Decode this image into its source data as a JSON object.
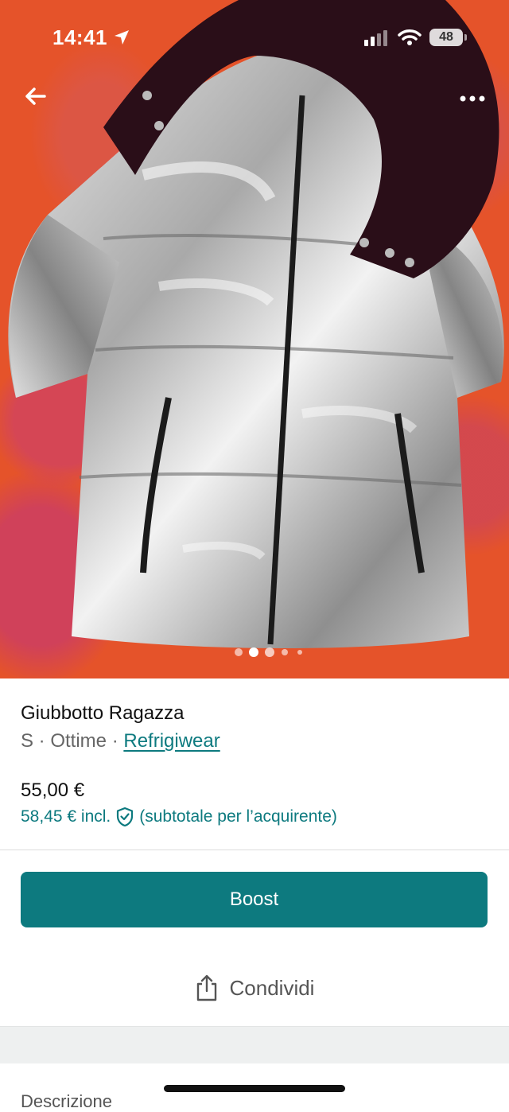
{
  "status_bar": {
    "time": "14:41",
    "battery": "48"
  },
  "gallery": {
    "image_count": 5,
    "active_index": 1
  },
  "item": {
    "title": "Giubbotto Ragazza",
    "size": "S",
    "condition": "Ottime",
    "separator": " · ",
    "brand": "Refrigiwear",
    "price": "55,00 €",
    "price_incl": "58,45 € incl.",
    "price_incl_note": "(subtotale per l’acquirente)"
  },
  "actions": {
    "boost_label": "Boost",
    "share_label": "Condividi"
  },
  "sections": {
    "description_label": "Descrizione"
  },
  "colors": {
    "accent": "#0d7a7f",
    "background_photo": "#e5532a"
  },
  "icons": [
    "back-arrow-icon",
    "more-icon",
    "location-arrow-icon",
    "signal-icon",
    "wifi-icon",
    "shield-check-icon",
    "share-icon"
  ]
}
